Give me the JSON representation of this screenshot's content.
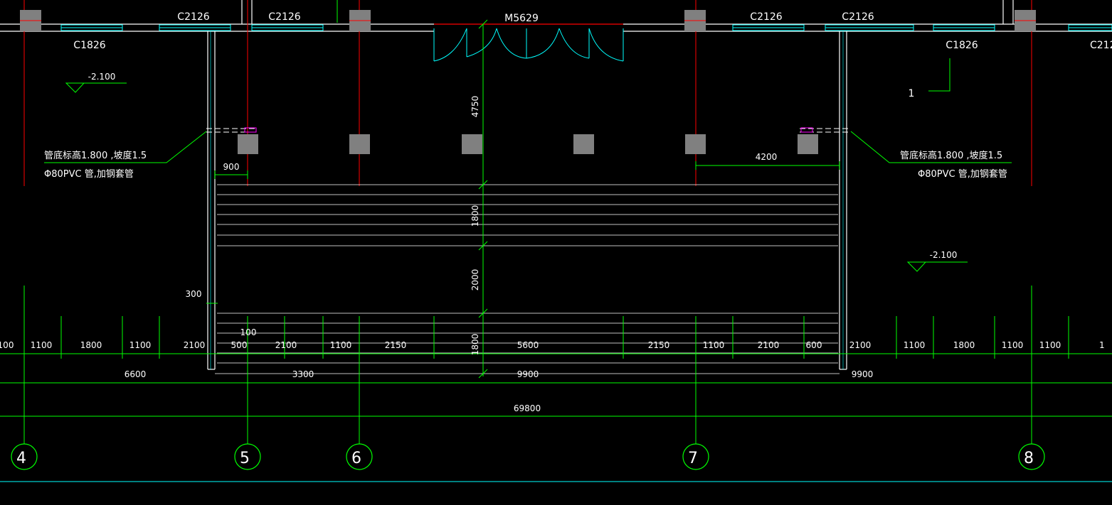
{
  "drawing": {
    "windows": [
      "C2126",
      "C2126",
      "C2126",
      "C2126",
      "C1826",
      "C1826",
      "C212"
    ],
    "door": "M5629",
    "level_marks": [
      "-2.100",
      "-2.100"
    ],
    "section_mark": "1",
    "pipe_note_line1": "管底标高1.800    ,坡度1.5",
    "pipe_note_line2": "Φ80PVC  管,加钢套管",
    "vertical_dims": [
      "4750",
      "1800",
      "2000",
      "1800"
    ],
    "left_dims": [
      "900",
      "300",
      "100"
    ],
    "right_dim": "4200",
    "row_dims": [
      "100",
      "1100",
      "1800",
      "1100",
      "2100",
      "500",
      "2100",
      "1100",
      "2150",
      "5600",
      "2150",
      "1100",
      "2100",
      "600",
      "2100",
      "1100",
      "1800",
      "1100",
      "1100",
      "1"
    ],
    "span_dims": [
      "6600",
      "3300",
      "9900",
      "9900"
    ],
    "total_dim": "69800",
    "axes": [
      "4",
      "5",
      "6",
      "7",
      "8"
    ]
  },
  "colors": {
    "background": "#000000",
    "wall": "#ffffff",
    "axis_line": "#ff0000",
    "dimension": "#00ff00",
    "window": "#00ffff",
    "column": "#808080"
  }
}
